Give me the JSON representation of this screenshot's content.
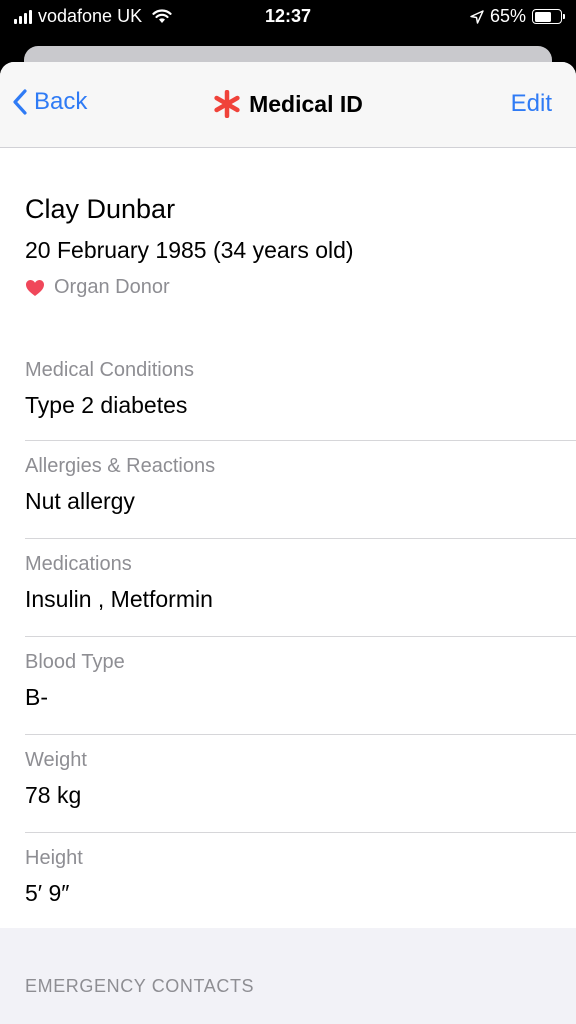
{
  "status_bar": {
    "carrier": "vodafone UK",
    "time": "12:37",
    "battery": "65%",
    "battery_level": 0.65
  },
  "nav": {
    "back_label": "Back",
    "title": "Medical ID",
    "edit_label": "Edit"
  },
  "profile": {
    "name": "Clay Dunbar",
    "dob": "20 February 1985 (34 years old)",
    "organ_donor": "Organ Donor"
  },
  "fields": [
    {
      "label": "Medical Conditions",
      "value": "Type 2 diabetes"
    },
    {
      "label": "Allergies & Reactions",
      "value": "Nut allergy"
    },
    {
      "label": "Medications",
      "value": "Insulin , Metformin"
    },
    {
      "label": "Blood Type",
      "value": "B-"
    },
    {
      "label": "Weight",
      "value": "78 kg"
    },
    {
      "label": "Height",
      "value": "5′ 9″"
    }
  ],
  "emergency_section_header": "EMERGENCY CONTACTS",
  "colors": {
    "accent_blue": "#2f7bf5",
    "medical_red": "#f0433a",
    "heart_pink": "#f0475a"
  }
}
